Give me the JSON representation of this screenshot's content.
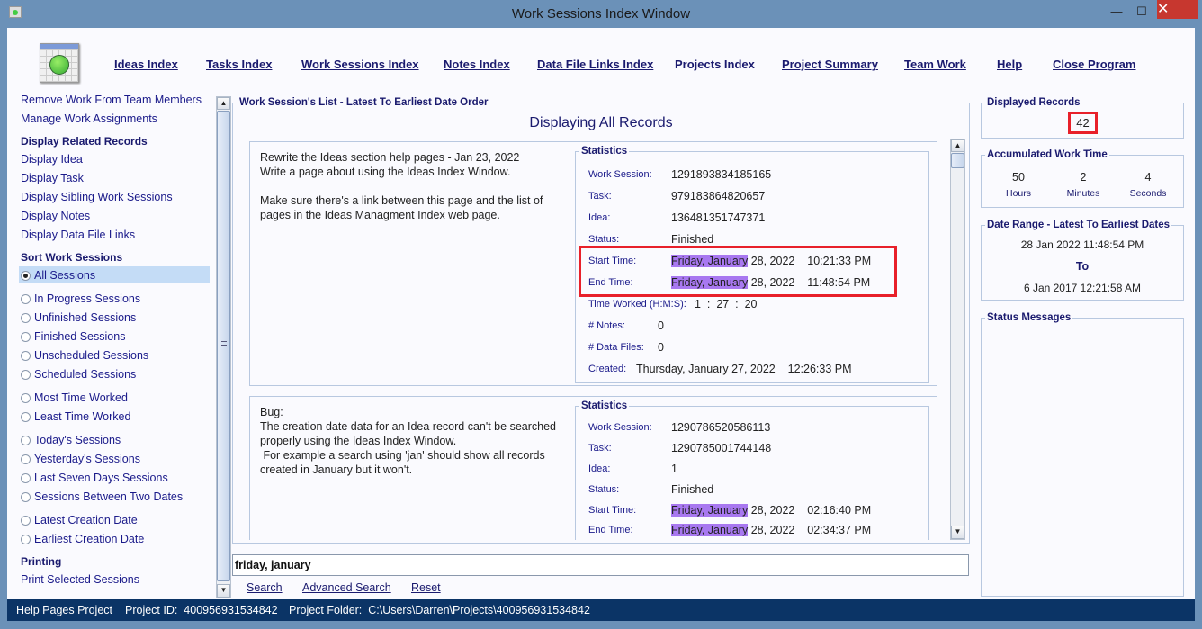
{
  "window": {
    "title": "Work Sessions Index Window",
    "minimize": "—",
    "maximize": "☐",
    "close": "✕"
  },
  "nav": [
    "Ideas Index",
    "Tasks Index",
    "Work Sessions Index",
    "Notes Index",
    "Data File Links Index",
    "Projects Index",
    "Project Summary",
    "Team Work",
    "Help",
    "Close Program"
  ],
  "sidebar": {
    "top_items": [
      "Remove Work From Team Members",
      "Manage Work Assignments"
    ],
    "related_header": "Display Related Records",
    "related_items": [
      "Display Idea",
      "Display Task",
      "Display Sibling Work Sessions",
      "Display Notes",
      "Display Data File Links"
    ],
    "sort_header": "Sort Work Sessions",
    "sort_options": [
      "All Sessions",
      "In Progress Sessions",
      "Unfinished Sessions",
      "Finished Sessions",
      "Unscheduled Sessions",
      "Scheduled Sessions",
      "Most Time Worked",
      "Least Time Worked",
      "Today's Sessions",
      "Yesterday's Sessions",
      "Last Seven Days Sessions",
      "Sessions Between Two Dates",
      "Latest Creation Date",
      "Earliest Creation Date"
    ],
    "selected_sort": "All Sessions",
    "printing_header": "Printing",
    "printing_items": [
      "Print Selected Sessions"
    ]
  },
  "list": {
    "title": "Work Session's List - Latest To Earliest Date Order",
    "subtitle": "Displaying All Records",
    "stats_title": "Statistics",
    "labels": {
      "work_session": "Work Session:",
      "task": "Task:",
      "idea": "Idea:",
      "status": "Status:",
      "start": "Start Time:",
      "end": "End Time:",
      "worked": "Time Worked (H:M:S):",
      "notes": "# Notes:",
      "files": "# Data Files:",
      "created": "Created:"
    },
    "records": [
      {
        "description": [
          "Rewrite the Ideas section help pages - Jan 23, 2022",
          "Write a page about using the Ideas Index Window.",
          "",
          "Make sure there's a link between this page and the list of",
          "pages in the Ideas Managment Index web page."
        ],
        "work_session": "1291893834185165",
        "task": "979183864820657",
        "idea": "136481351747371",
        "status": "Finished",
        "start_hl": "Friday, January",
        "start_rest": "28, 2022    10:21:33 PM",
        "end_hl": "Friday, January",
        "end_rest": "28, 2022    11:48:54 PM",
        "worked_h": "1",
        "worked_m": "27",
        "worked_s": "20",
        "notes": "0",
        "files": "0",
        "created": "Thursday, January 27, 2022    12:26:33 PM"
      },
      {
        "description": [
          "Bug:",
          "The creation date data for an Idea record can't be searched",
          "properly using the Ideas Index Window.",
          " For example a search using 'jan' should show all records",
          "created in January but it won't."
        ],
        "work_session": "1290786520586113",
        "task": "1290785001744148",
        "idea": "1",
        "status": "Finished",
        "start_hl": "Friday, January",
        "start_rest": "28, 2022    02:16:40 PM",
        "end_hl": "Friday, January",
        "end_rest": "28, 2022    02:34:37 PM"
      }
    ]
  },
  "search": {
    "value": "friday, january",
    "search": "Search",
    "advanced": "Advanced Search",
    "reset": "Reset"
  },
  "right": {
    "displayed_title": "Displayed Records",
    "displayed": "42",
    "accum_title": "Accumulated Work Time",
    "hours": "50",
    "hours_label": "Hours",
    "minutes": "2",
    "minutes_label": "Minutes",
    "seconds": "4",
    "seconds_label": "Seconds",
    "range_title": "Date Range - Latest To Earliest Dates",
    "range_latest": "28 Jan 2022  11:48:54 PM",
    "range_to": "To",
    "range_earliest": "6 Jan 2017  12:21:58 AM",
    "status_title": "Status Messages"
  },
  "statusbar": {
    "project": "Help Pages Project",
    "project_id": "Project ID:  400956931534842",
    "folder": "Project Folder:  C:\\Users\\Darren\\Projects\\400956931534842"
  },
  "colors": {
    "highlight": "#a878f0",
    "annotation_box": "#e8202a",
    "statusbar": "#0b3466",
    "frame": "#6b91b8"
  }
}
